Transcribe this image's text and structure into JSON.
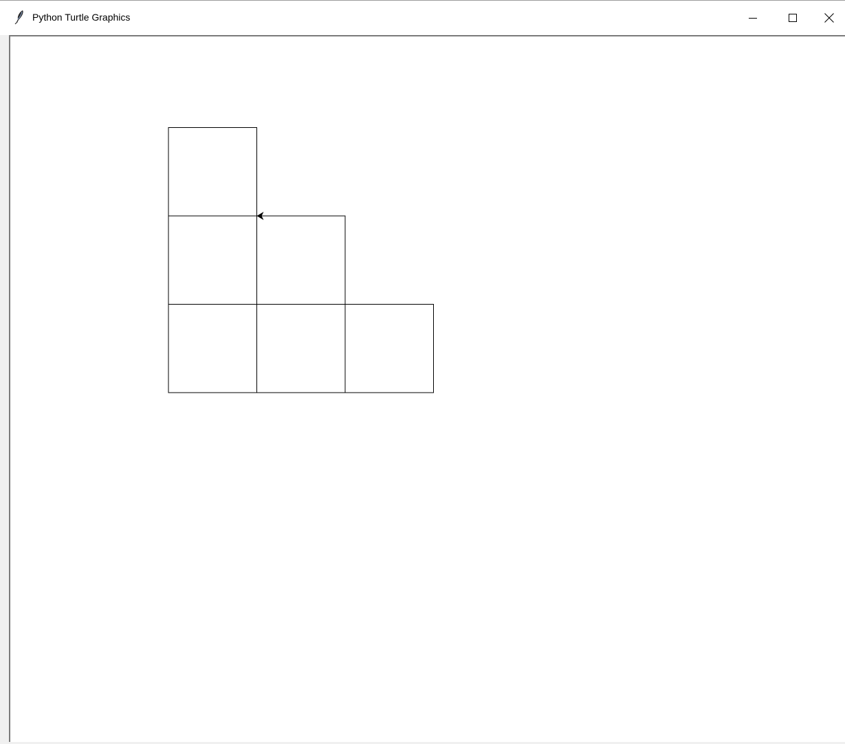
{
  "window": {
    "title": "Python Turtle Graphics",
    "app_icon": "feather-icon",
    "controls": {
      "minimize_icon": "minimize-icon",
      "maximize_icon": "maximize-icon",
      "close_icon": "close-icon"
    }
  },
  "turtle": {
    "shape": "classic",
    "heading_deg": 180,
    "pen_color": "#000000",
    "square_size": 100,
    "squares": [
      {
        "col": 0,
        "row": 0
      },
      {
        "col": 1,
        "row": 0
      },
      {
        "col": 2,
        "row": 0
      },
      {
        "col": 0,
        "row": 1
      },
      {
        "col": 1,
        "row": 1
      },
      {
        "col": 0,
        "row": 2
      }
    ],
    "position": {
      "col": 1,
      "row": 2
    }
  }
}
